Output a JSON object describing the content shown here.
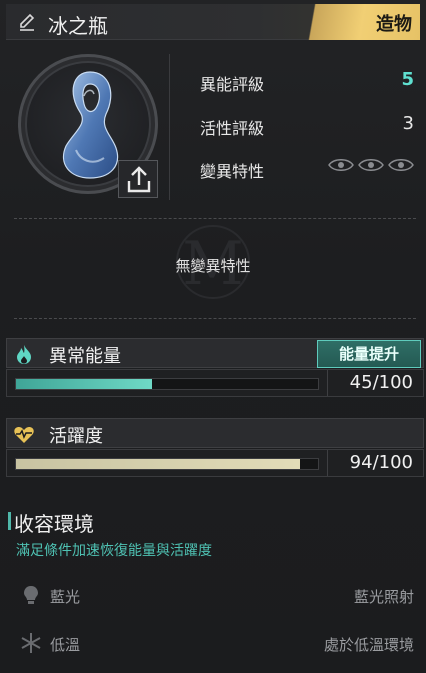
{
  "header": {
    "title": "冰之瓶",
    "tag": "造物"
  },
  "stats": [
    {
      "label": "異能評級",
      "value": "5"
    },
    {
      "label": "活性評級",
      "value": "3"
    },
    {
      "label": "變異特性",
      "value": ""
    }
  ],
  "mutation": {
    "none_text": "無變異特性"
  },
  "energy": {
    "label": "異常能量",
    "boost_label": "能量提升",
    "value_text": "45/100",
    "fraction": 0.45
  },
  "vitality": {
    "label": "活躍度",
    "value_text": "94/100",
    "fraction": 0.94
  },
  "containment": {
    "title": "收容環境",
    "subtitle": "滿足條件加速恢復能量與活躍度",
    "conditions": [
      {
        "name": "藍光",
        "desc": "藍光照射",
        "icon": "lightbulb-icon"
      },
      {
        "name": "低溫",
        "desc": "處於低溫環境",
        "icon": "snowflake-icon"
      }
    ]
  },
  "colors": {
    "accent": "#5fe0d0",
    "tag_gold": "#f1cf74",
    "energy_fill": "#6fd9c6",
    "vital_fill": "#e2dcb8"
  }
}
